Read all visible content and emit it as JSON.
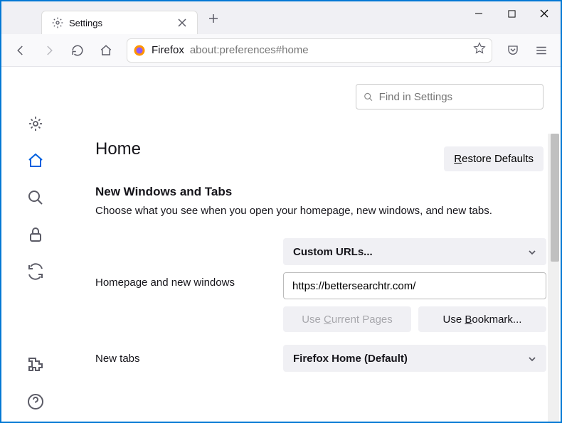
{
  "window": {
    "tab_title": "Settings"
  },
  "urlbar": {
    "product": "Firefox",
    "url": "about:preferences#home"
  },
  "search": {
    "placeholder": "Find in Settings"
  },
  "page": {
    "title": "Home",
    "restore_label": "Restore Defaults"
  },
  "section": {
    "heading": "New Windows and Tabs",
    "description": "Choose what you see when you open your homepage, new windows, and new tabs."
  },
  "homepage": {
    "label": "Homepage and new windows",
    "dropdown": "Custom URLs...",
    "url_value": "https://bettersearchtr.com/",
    "use_current": "Use Current Pages",
    "use_bookmark": "Use Bookmark..."
  },
  "newtabs": {
    "label": "New tabs",
    "dropdown": "Firefox Home (Default)"
  }
}
